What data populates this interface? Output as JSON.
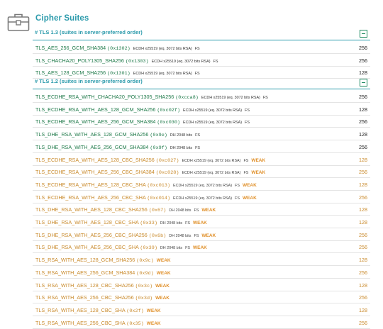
{
  "page": {
    "title": "Cipher Suites"
  },
  "sections": [
    {
      "title": "# TLS 1.3 (suites in server-preferred order)",
      "rows": [
        {
          "name": "TLS_AES_256_GCM_SHA384",
          "hex": "(0x1302)",
          "kx": "ECDH x25519 (eq. 3072 bits RSA)",
          "fs": "FS",
          "weak": "",
          "bits": "256",
          "status": "strong"
        },
        {
          "name": "TLS_CHACHA20_POLY1305_SHA256",
          "hex": "(0x1303)",
          "kx": "ECDH x25519 (eq. 3072 bits RSA)",
          "fs": "FS",
          "weak": "",
          "bits": "256",
          "status": "strong"
        },
        {
          "name": "TLS_AES_128_GCM_SHA256",
          "hex": "(0x1301)",
          "kx": "ECDH x25519 (eq. 3072 bits RSA)",
          "fs": "FS",
          "weak": "",
          "bits": "128",
          "status": "strong"
        }
      ]
    },
    {
      "title": "# TLS 1.2 (suites in server-preferred order)",
      "rows": [
        {
          "name": "TLS_ECDHE_RSA_WITH_CHACHA20_POLY1305_SHA256",
          "hex": "(0xcca8)",
          "kx": "ECDH x25519 (eq. 3072 bits RSA)",
          "fs": "FS",
          "weak": "",
          "bits": "256",
          "status": "strong"
        },
        {
          "name": "TLS_ECDHE_RSA_WITH_AES_128_GCM_SHA256",
          "hex": "(0xc02f)",
          "kx": "ECDH x25519 (eq. 3072 bits RSA)",
          "fs": "FS",
          "weak": "",
          "bits": "128",
          "status": "strong"
        },
        {
          "name": "TLS_ECDHE_RSA_WITH_AES_256_GCM_SHA384",
          "hex": "(0xc030)",
          "kx": "ECDH x25519 (eq. 3072 bits RSA)",
          "fs": "FS",
          "weak": "",
          "bits": "256",
          "status": "strong"
        },
        {
          "name": "TLS_DHE_RSA_WITH_AES_128_GCM_SHA256",
          "hex": "(0x9e)",
          "kx": "DH 2048 bits",
          "fs": "FS",
          "weak": "",
          "bits": "128",
          "status": "strong"
        },
        {
          "name": "TLS_DHE_RSA_WITH_AES_256_GCM_SHA384",
          "hex": "(0x9f)",
          "kx": "DH 2048 bits",
          "fs": "FS",
          "weak": "",
          "bits": "256",
          "status": "strong"
        },
        {
          "name": "TLS_ECDHE_RSA_WITH_AES_128_CBC_SHA256",
          "hex": "(0xc027)",
          "kx": "ECDH x25519 (eq. 3072 bits RSA)",
          "fs": "FS",
          "weak": "WEAK",
          "bits": "128",
          "status": "weak"
        },
        {
          "name": "TLS_ECDHE_RSA_WITH_AES_256_CBC_SHA384",
          "hex": "(0xc028)",
          "kx": "ECDH x25519 (eq. 3072 bits RSA)",
          "fs": "FS",
          "weak": "WEAK",
          "bits": "256",
          "status": "weak"
        },
        {
          "name": "TLS_ECDHE_RSA_WITH_AES_128_CBC_SHA",
          "hex": "(0xc013)",
          "kx": "ECDH x25519 (eq. 3072 bits RSA)",
          "fs": "FS",
          "weak": "WEAK",
          "bits": "128",
          "status": "weak"
        },
        {
          "name": "TLS_ECDHE_RSA_WITH_AES_256_CBC_SHA",
          "hex": "(0xc014)",
          "kx": "ECDH x25519 (eq. 3072 bits RSA)",
          "fs": "FS",
          "weak": "WEAK",
          "bits": "256",
          "status": "weak"
        },
        {
          "name": "TLS_DHE_RSA_WITH_AES_128_CBC_SHA256",
          "hex": "(0x67)",
          "kx": "DH 2048 bits",
          "fs": "FS",
          "weak": "WEAK",
          "bits": "128",
          "status": "weak"
        },
        {
          "name": "TLS_DHE_RSA_WITH_AES_128_CBC_SHA",
          "hex": "(0x33)",
          "kx": "DH 2048 bits",
          "fs": "FS",
          "weak": "WEAK",
          "bits": "128",
          "status": "weak"
        },
        {
          "name": "TLS_DHE_RSA_WITH_AES_256_CBC_SHA256",
          "hex": "(0x6b)",
          "kx": "DH 2048 bits",
          "fs": "FS",
          "weak": "WEAK",
          "bits": "256",
          "status": "weak"
        },
        {
          "name": "TLS_DHE_RSA_WITH_AES_256_CBC_SHA",
          "hex": "(0x39)",
          "kx": "DH 2048 bits",
          "fs": "FS",
          "weak": "WEAK",
          "bits": "256",
          "status": "weak"
        },
        {
          "name": "TLS_RSA_WITH_AES_128_GCM_SHA256",
          "hex": "(0x9c)",
          "kx": "",
          "fs": "",
          "weak": "WEAK",
          "bits": "128",
          "status": "weak"
        },
        {
          "name": "TLS_RSA_WITH_AES_256_GCM_SHA384",
          "hex": "(0x9d)",
          "kx": "",
          "fs": "",
          "weak": "WEAK",
          "bits": "256",
          "status": "weak"
        },
        {
          "name": "TLS_RSA_WITH_AES_128_CBC_SHA256",
          "hex": "(0x3c)",
          "kx": "",
          "fs": "",
          "weak": "WEAK",
          "bits": "128",
          "status": "weak"
        },
        {
          "name": "TLS_RSA_WITH_AES_256_CBC_SHA256",
          "hex": "(0x3d)",
          "kx": "",
          "fs": "",
          "weak": "WEAK",
          "bits": "256",
          "status": "weak"
        },
        {
          "name": "TLS_RSA_WITH_AES_128_CBC_SHA",
          "hex": "(0x2f)",
          "kx": "",
          "fs": "",
          "weak": "WEAK",
          "bits": "128",
          "status": "weak"
        },
        {
          "name": "TLS_RSA_WITH_AES_256_CBC_SHA",
          "hex": "(0x35)",
          "kx": "",
          "fs": "",
          "weak": "WEAK",
          "bits": "256",
          "status": "weak"
        }
      ]
    }
  ],
  "colors": {
    "accent": "#2a9aab",
    "strong": "#1f7a4a",
    "weak": "#c98a2b",
    "weak_badge": "#e0902a"
  },
  "icons": {
    "header": "briefcase-lock-icon",
    "collapse": "collapse-minus-icon"
  }
}
